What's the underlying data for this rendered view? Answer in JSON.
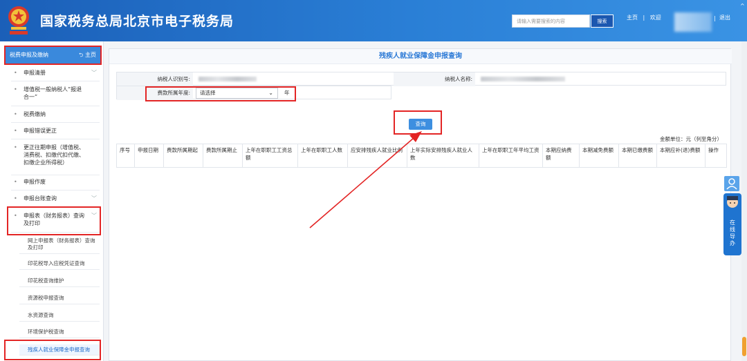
{
  "header": {
    "site_title": "国家税务总局北京市电子税务局",
    "search_placeholder": "请输入需要搜索的内容",
    "search_button": "搜索",
    "home_link": "主页",
    "separator": "|",
    "welcome": "欢迎",
    "logout": "退出",
    "scroll_up": "^",
    "colors": {
      "header_start": "#1b5fb8",
      "header_end": "#3a93e4",
      "accent": "#2c7ad6",
      "highlight": "#e32424"
    }
  },
  "sidebar": {
    "section_title": "税费申报及缴纳",
    "home_link": "主页",
    "items": [
      {
        "label": "申报清册",
        "has_chevron": true
      },
      {
        "label": "增值税一般纳税人“报退合一”",
        "has_chevron": false
      },
      {
        "label": "税费缴纳",
        "has_chevron": false
      },
      {
        "label": "申报错误更正",
        "has_chevron": false
      },
      {
        "label": "更正往期申报（增值税、消费税、扣缴代扣代缴、扣缴企业所得税）",
        "has_chevron": false
      },
      {
        "label": "申报作废",
        "has_chevron": false
      },
      {
        "label": "申报台账查询",
        "has_chevron": true
      },
      {
        "label": "申报表（财务报表）查询及打印",
        "has_chevron": true
      }
    ],
    "sub_items": [
      {
        "label": "网上申报表（财务报表）查询及打印"
      },
      {
        "label": "印花税导入应税凭证查询"
      },
      {
        "label": "印花税查询维护"
      },
      {
        "label": "资源税申报查询"
      },
      {
        "label": "水资源查询"
      },
      {
        "label": "环境保护税查询"
      },
      {
        "label": "残疾人就业保障金申报查询"
      }
    ]
  },
  "main": {
    "title": "残疾人就业保障金申报查询",
    "taxpayer_id_label": "纳税人识别号:",
    "taxpayer_name_label": "纳税人名称:",
    "year_label": "费款所属年度:",
    "year_select_value": "请选择",
    "year_suffix": "年",
    "query_button": "查询",
    "unit_text": "金额单位：元（列至角分）",
    "table_headers": [
      "序号",
      "申报日期",
      "费款所属期起",
      "费款所属期止",
      "上年在职职工工资总额",
      "上年在职职工人数",
      "应安排残疾人就业比例",
      "上年实际安排残疾人就业人数",
      "上年在职职工年平均工资",
      "本期应纳费额",
      "本期减免费额",
      "本期已缴费额",
      "本期应补(退)费额",
      "操作"
    ]
  },
  "float_widget": {
    "label": "在线导办"
  }
}
